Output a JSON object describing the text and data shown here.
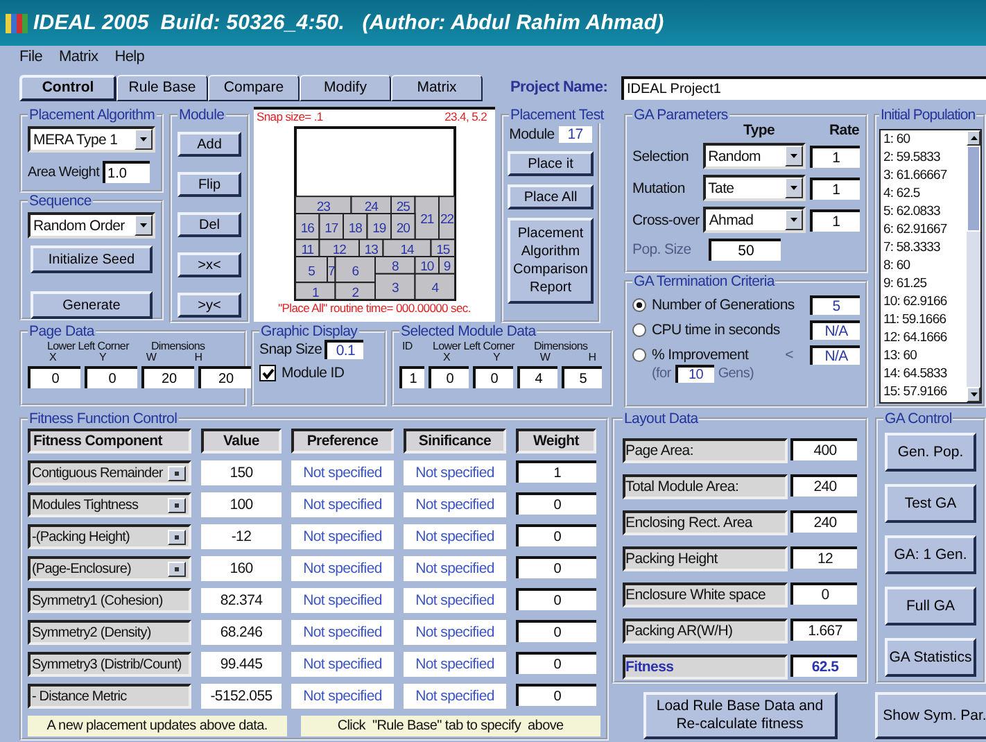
{
  "window": {
    "title": "IDEAL 2005  Build: 50326_4:50.   (Author: Abdul Rahim Ahmad)"
  },
  "menu": [
    "File",
    "Matrix",
    "Help"
  ],
  "tabs": [
    {
      "label": "Control",
      "selected": true
    },
    {
      "label": "Rule Base",
      "selected": false
    },
    {
      "label": "Compare",
      "selected": false
    },
    {
      "label": "Modify",
      "selected": false
    },
    {
      "label": "Matrix",
      "selected": false
    }
  ],
  "project": {
    "label": "Project Name:",
    "value": "IDEAL Project1"
  },
  "placement_algorithm": {
    "title": "Placement Algorithm",
    "algorithm": "MERA Type 1",
    "area_weight_label": "Area Weight",
    "area_weight": "1.0"
  },
  "sequence": {
    "title": "Sequence",
    "order": "Random Order",
    "buttons": [
      "Initialize Seed",
      "Generate"
    ]
  },
  "module": {
    "title": "Module",
    "buttons": [
      "Add",
      "Flip",
      "Del",
      ">x<",
      ">y<"
    ]
  },
  "canvas": {
    "snap_text": "Snap size=  .1",
    "coords": "23.4,  5.2",
    "timing": "\"Place All\" routine time= 000.00000 sec.",
    "modules": [
      "23",
      "24",
      "25",
      "21",
      "22",
      "16",
      "17",
      "18",
      "19",
      "20",
      "11",
      "12",
      "13",
      "14",
      "15",
      "5",
      "7",
      "6",
      "8",
      "10",
      "9",
      "3",
      "4",
      "1",
      "2"
    ]
  },
  "placement_test": {
    "title": "Placement Test",
    "module_label": "Module",
    "module": "17",
    "buttons": [
      "Place it",
      "Place All",
      "Placement Algorithm Comparison Report"
    ]
  },
  "ga_parameters": {
    "title": "GA Parameters",
    "headers": [
      "Type",
      "Rate"
    ],
    "rows": [
      {
        "label": "Selection",
        "type": "Random",
        "rate": "1"
      },
      {
        "label": "Mutation",
        "type": "Tate",
        "rate": "1"
      },
      {
        "label": "Cross-over",
        "type": "Ahmad",
        "rate": "1"
      }
    ],
    "pop_size": {
      "label": "Pop. Size",
      "value": "50",
      "disabled": true
    }
  },
  "ga_termination": {
    "title": "GA Termination Criteria",
    "options": [
      {
        "label": "Number of Generations",
        "value": "5",
        "selected": true
      },
      {
        "label": "CPU time in seconds",
        "value": "N/A",
        "selected": false
      },
      {
        "label": "% Improvement",
        "value": "N/A",
        "selected": false
      }
    ],
    "less_than": "<",
    "for_label": "(for",
    "gens": "10",
    "gens_label": "Gens)"
  },
  "initial_population": {
    "title": "Initial Population",
    "items": [
      "1: 60",
      "2: 59.5833",
      "3: 61.66667",
      "4: 62.5",
      "5: 62.0833",
      "6: 62.91667",
      "7: 58.3333",
      "8: 60",
      "9: 61.25",
      "10: 62.9166",
      "11: 59.1666",
      "12: 64.1666",
      "13: 60",
      "14: 64.5833",
      "15: 57.9166"
    ]
  },
  "page_data": {
    "title": "Page Data",
    "corner_label": "Lower Left Corner",
    "dimensions_label": "Dimensions",
    "axes": [
      "X",
      "Y",
      "W",
      "H"
    ],
    "values": [
      "0",
      "0",
      "20",
      "20"
    ]
  },
  "graphic_display": {
    "title": "Graphic Display",
    "snap_label": "Snap Size",
    "snap": "0.1",
    "module_id_label": "Module ID",
    "module_id": true
  },
  "selected_module": {
    "title": "Selected Module Data",
    "id_label": "ID",
    "corner_label": "Lower Left Corner",
    "dimensions_label": "Dimensions",
    "axes": [
      "X",
      "Y",
      "W",
      "H"
    ],
    "values": [
      "1",
      "0",
      "0",
      "4",
      "5"
    ]
  },
  "fitness": {
    "title": "Fitness Function Control",
    "columns": [
      "Fitness Component",
      "Value",
      "Preference",
      "Sinificance",
      "Weight"
    ],
    "rows": [
      {
        "kind": "dropdown",
        "component": "Contiguous Remainder",
        "value": "150",
        "preference": "Not specified",
        "significance": "Not specified",
        "weight": "1"
      },
      {
        "kind": "dropdown",
        "component": "Modules Tightness",
        "value": "100",
        "preference": "Not specified",
        "significance": "Not specified",
        "weight": "0"
      },
      {
        "kind": "dropdown",
        "component": "-(Packing Height)",
        "value": "-12",
        "preference": "Not specified",
        "significance": "Not specified",
        "weight": "0"
      },
      {
        "kind": "dropdown",
        "component": "(Page-Enclosure)",
        "value": "160",
        "preference": "Not specified",
        "significance": "Not specified",
        "weight": "0"
      },
      {
        "kind": "label",
        "component": "Symmetry1 (Cohesion)",
        "value": "82.374",
        "preference": "Not specified",
        "significance": "Not specified",
        "weight": "0"
      },
      {
        "kind": "label",
        "component": "Symmetry2 (Density)",
        "value": "68.246",
        "preference": "Not specified",
        "significance": "Not specified",
        "weight": "0"
      },
      {
        "kind": "label",
        "component": "Symmetry3 (Distrib/Count)",
        "value": "99.445",
        "preference": "Not specified",
        "significance": "Not specified",
        "weight": "0"
      },
      {
        "kind": "label",
        "component": "- Distance Metric",
        "value": "-5152.055",
        "preference": "Not specified",
        "significance": "Not specified",
        "weight": "0"
      }
    ],
    "notes": [
      "A new placement updates above data.",
      "Click  \"Rule Base\" tab to specify  above"
    ]
  },
  "layout_data": {
    "title": "Layout Data",
    "rows": [
      {
        "kind": "plain",
        "label": "Page Area:",
        "value": "400"
      },
      {
        "kind": "plain",
        "label": "Total Module Area:",
        "value": "240"
      },
      {
        "kind": "plain",
        "label": "Enclosing Rect. Area",
        "value": "240"
      },
      {
        "kind": "plain",
        "label": "Packing Height",
        "value": "12"
      },
      {
        "kind": "plain",
        "label": "Enclosure White space",
        "value": "0"
      },
      {
        "kind": "plain",
        "label": "Packing AR(W/H)",
        "value": "1.667"
      },
      {
        "kind": "total",
        "label": "Fitness",
        "value": "62.5"
      }
    ]
  },
  "ga_control": {
    "title": "GA Control",
    "buttons": [
      "Gen. Pop.",
      "Test GA",
      "GA: 1 Gen.",
      "Full GA",
      "GA Statistics"
    ]
  },
  "bottom_buttons": [
    "Load Rule Base Data and Re-calculate fitness",
    "Show Sym. Par."
  ]
}
